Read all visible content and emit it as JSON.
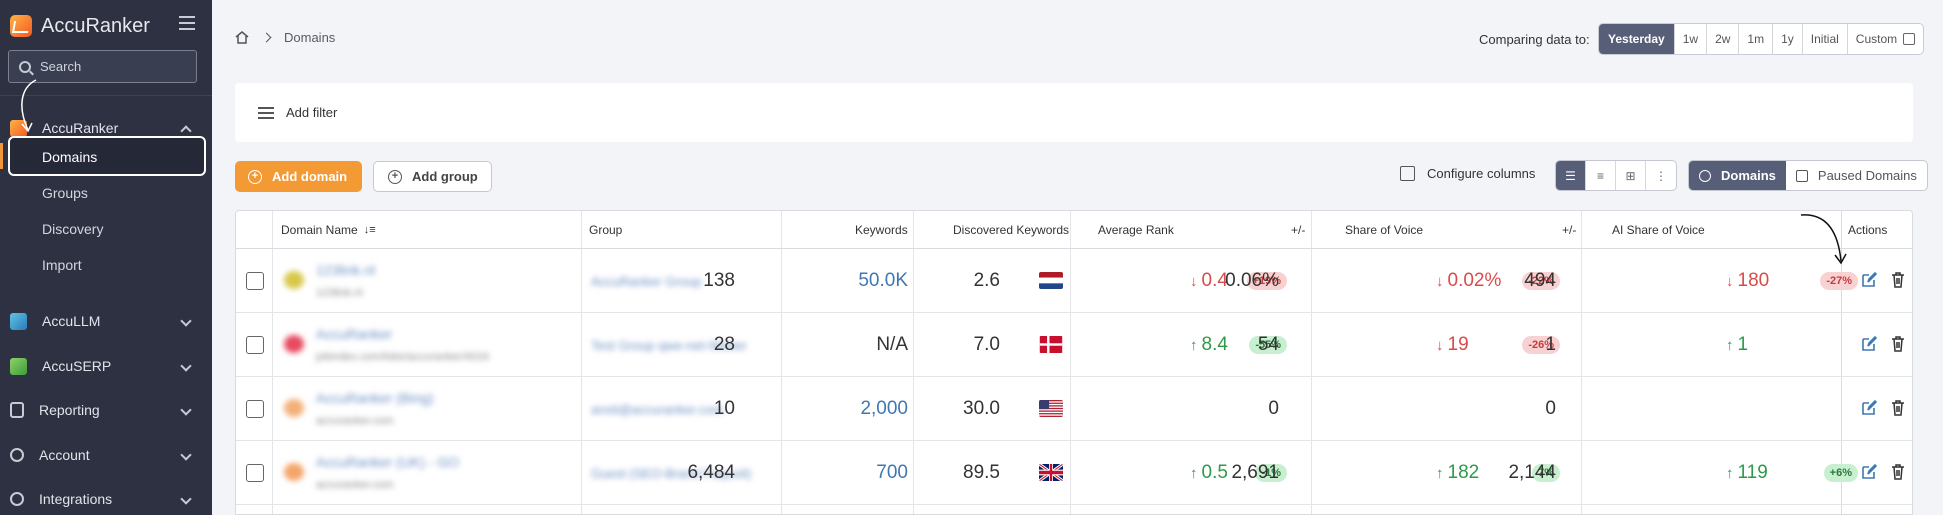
{
  "sidebar": {
    "brand": "AccuRanker",
    "search_placeholder": "Search",
    "groups": [
      {
        "label": "AccuRanker",
        "sub": [
          "Domains",
          "Groups",
          "Discovery",
          "Import"
        ]
      },
      {
        "label": "AccuLLM"
      },
      {
        "label": "AccuSERP"
      },
      {
        "label": "Reporting"
      },
      {
        "label": "Account"
      },
      {
        "label": "Integrations"
      }
    ]
  },
  "breadcrumb": {
    "current": "Domains"
  },
  "compare": {
    "label": "Comparing data to:",
    "options": [
      "Yesterday",
      "1w",
      "2w",
      "1m",
      "1y",
      "Initial",
      "Custom"
    ]
  },
  "filter": {
    "add_label": "Add filter"
  },
  "toolbar": {
    "add_domain": "Add domain",
    "add_group": "Add group",
    "configure_columns": "Configure columns",
    "domains_tab": "Domains",
    "paused_tab": "Paused Domains"
  },
  "table": {
    "headers": {
      "domain": "Domain Name",
      "group": "Group",
      "keywords": "Keywords",
      "discovered": "Discovered Keywords",
      "avg_rank": "Average Rank",
      "pm1": "+/-",
      "sov": "Share of Voice",
      "pm2": "+/-",
      "ai_sov": "AI Share of Voice",
      "actions": "Actions"
    },
    "rows": [
      {
        "domain": "123link.nl",
        "url": "123link.nl",
        "group": "AccuRanker Group",
        "keywords": "138",
        "discovered": "50.0K",
        "flag": "nl",
        "avg_rank": "2.6",
        "rank_change": "0.4",
        "rank_dir": "down",
        "rank_badge": "+19%",
        "rank_badge_type": "rd",
        "sov": "0.06%",
        "sov_change": "0.02%",
        "sov_dir": "down",
        "sov_badge": "-22%",
        "sov_badge_type": "rd",
        "ai_sov": "494",
        "ai_change": "180",
        "ai_dir": "down",
        "ai_badge": "-27%",
        "ai_badge_type": "rd"
      },
      {
        "domain": "AccuRanker",
        "url": "jobindex.com/lobs/accuranker/4016",
        "group": "Test Group qwe-net-Weber",
        "keywords": "28",
        "discovered": "N/A",
        "flag": "dk",
        "avg_rank": "7.0",
        "rank_change": "8.4",
        "rank_dir": "up",
        "rank_badge": "-55%",
        "rank_badge_type": "g",
        "sov": "54",
        "sov_change": "19",
        "sov_dir": "down",
        "sov_badge": "-26%",
        "sov_badge_type": "rd",
        "ai_sov": "1",
        "ai_change": "1",
        "ai_dir": "up",
        "ai_badge": "",
        "ai_badge_type": "g"
      },
      {
        "domain": "AccuRanker (Bing)",
        "url": "accuranker.com",
        "group": "ansti@accuranker.com",
        "keywords": "10",
        "discovered": "2,000",
        "flag": "us",
        "avg_rank": "30.0",
        "rank_change": "",
        "rank_dir": "",
        "rank_badge": "",
        "rank_badge_type": "g",
        "sov": "0",
        "sov_change": "",
        "sov_dir": "",
        "sov_badge": "",
        "sov_badge_type": "g",
        "ai_sov": "0",
        "ai_change": "",
        "ai_dir": "",
        "ai_badge": "",
        "ai_badge_type": "g"
      },
      {
        "domain": "AccuRanker (UK) - GO",
        "url": "accuranker.com",
        "group": "Guest (SEO-Brand Faquoit)",
        "keywords": "6,484",
        "discovered": "700",
        "flag": "uk",
        "avg_rank": "89.5",
        "rank_change": "0.5",
        "rank_dir": "up",
        "rank_badge": "-1%",
        "rank_badge_type": "g",
        "sov": "2,691",
        "sov_change": "182",
        "sov_dir": "up",
        "sov_badge": "7%",
        "sov_badge_type": "g",
        "ai_sov": "2,144",
        "ai_change": "119",
        "ai_dir": "up",
        "ai_badge": "+6%",
        "ai_badge_type": "g"
      }
    ]
  },
  "colors": {
    "sidebar_bg": "#2e3142",
    "accent_orange": "#f39a34",
    "toggle_active": "#575e78",
    "link_blue": "#3e78b2",
    "up_green": "#2d9a4a",
    "down_red": "#d94b4b"
  },
  "icons": [
    "hamburger-icon",
    "search-icon",
    "home-icon",
    "calendar-icon",
    "filter-icon",
    "plus-circle-icon",
    "columns-icon",
    "globe-icon",
    "pause-icon",
    "edit-icon",
    "trash-icon",
    "sort-icon",
    "chevron-down-icon",
    "chevron-up-icon"
  ]
}
